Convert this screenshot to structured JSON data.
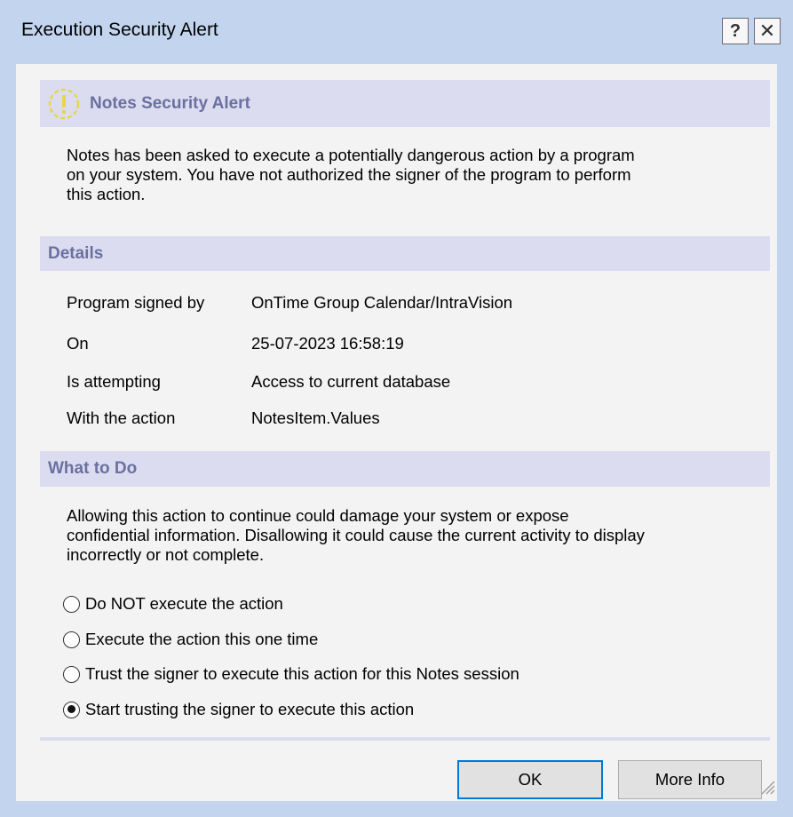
{
  "window": {
    "title": "Execution Security Alert",
    "help_label": "?",
    "close_label": "✕"
  },
  "alert": {
    "heading": "Notes Security Alert",
    "message_line1": "Notes has been asked to execute a potentially dangerous action by a program",
    "message_line2": "on your system.  You have not authorized the signer of the program to perform",
    "message_line3": "this action."
  },
  "details": {
    "heading": "Details",
    "rows": [
      {
        "label": "Program signed by",
        "value": "OnTime Group Calendar/IntraVision"
      },
      {
        "label": "On",
        "value": "25-07-2023 16:58:19"
      },
      {
        "label": "Is attempting",
        "value": "Access to current database"
      },
      {
        "label": "With the action",
        "value": "NotesItem.Values"
      }
    ]
  },
  "what_to_do": {
    "heading": "What to Do",
    "message_line1": "Allowing this action to continue could damage your system or expose",
    "message_line2": "confidential information. Disallowing it could cause the current activity to display",
    "message_line3": "incorrectly or not complete.",
    "options": [
      {
        "label": "Do NOT execute the action",
        "selected": false
      },
      {
        "label": "Execute the action this one time",
        "selected": false
      },
      {
        "label": "Trust the signer to execute this action for this Notes session",
        "selected": false
      },
      {
        "label": "Start trusting the signer to execute this action",
        "selected": true
      }
    ]
  },
  "buttons": {
    "ok_label": "OK",
    "more_info_label": "More Info"
  },
  "colors": {
    "window_frame": "#c3d5ee",
    "section_bar": "#dcdcf0",
    "section_text": "#6a71a0",
    "alert_icon": "#e7d64a"
  }
}
